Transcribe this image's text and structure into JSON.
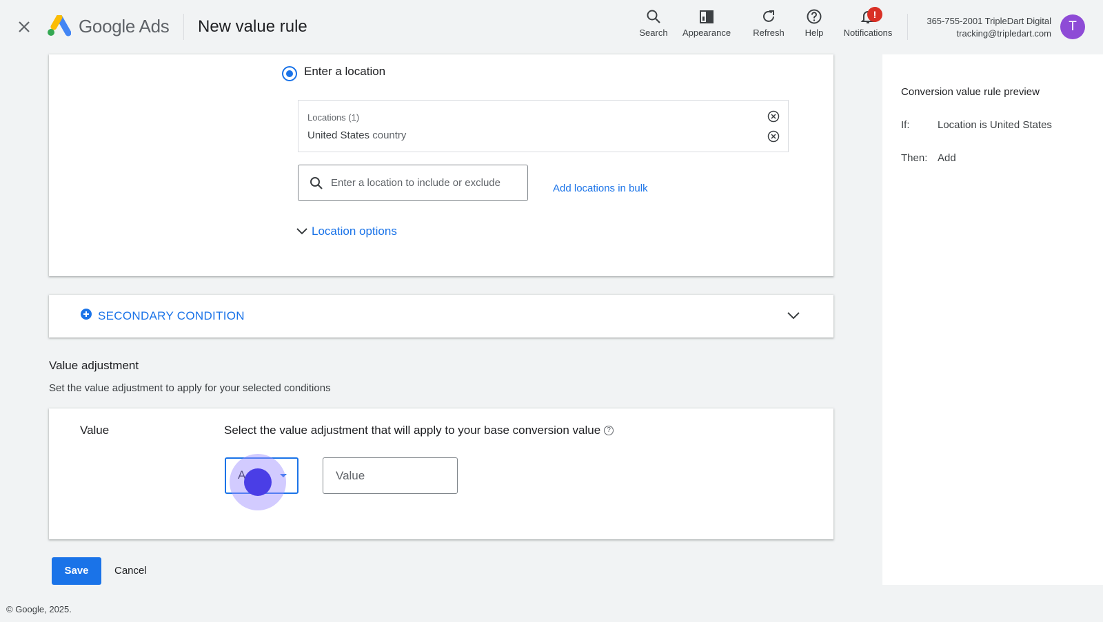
{
  "header": {
    "brand": "Google Ads",
    "page_title": "New value rule",
    "tools": [
      {
        "label": "Search",
        "icon": "search-icon"
      },
      {
        "label": "Appearance",
        "icon": "appearance-icon"
      },
      {
        "label": "Refresh",
        "icon": "refresh-icon"
      },
      {
        "label": "Help",
        "icon": "help-icon"
      },
      {
        "label": "Notifications",
        "icon": "notifications-icon",
        "badge": "!"
      }
    ],
    "account": {
      "line1": "365-755-2001 TripleDart Digital",
      "line2": "tracking@tripledart.com",
      "avatar_letter": "T"
    }
  },
  "location_section": {
    "radio_label": "Enter a location",
    "locations_header": "Locations (1)",
    "locations": [
      {
        "name": "United States",
        "type": "country"
      }
    ],
    "search_placeholder": "Enter a location to include or exclude",
    "bulk_link": "Add locations in bulk",
    "options_label": "Location options"
  },
  "secondary_condition": {
    "label": "SECONDARY CONDITION"
  },
  "value_adjustment": {
    "title": "Value adjustment",
    "subtitle": "Set the value adjustment to apply for your selected conditions",
    "row_label": "Value",
    "description": "Select the value adjustment that will apply to your base conversion value",
    "help_glyph": "?",
    "select_value": "A",
    "value_placeholder": "Value"
  },
  "actions": {
    "save": "Save",
    "cancel": "Cancel"
  },
  "footer": "© Google, 2025.",
  "preview": {
    "title": "Conversion value rule preview",
    "if_key": "If:",
    "if_value": "Location is United States",
    "then_key": "Then:",
    "then_value": "Add"
  },
  "colors": {
    "accent": "#1a73e8",
    "avatar": "#8e4bd6",
    "badge": "#d93025",
    "background": "#f1f3f4"
  }
}
